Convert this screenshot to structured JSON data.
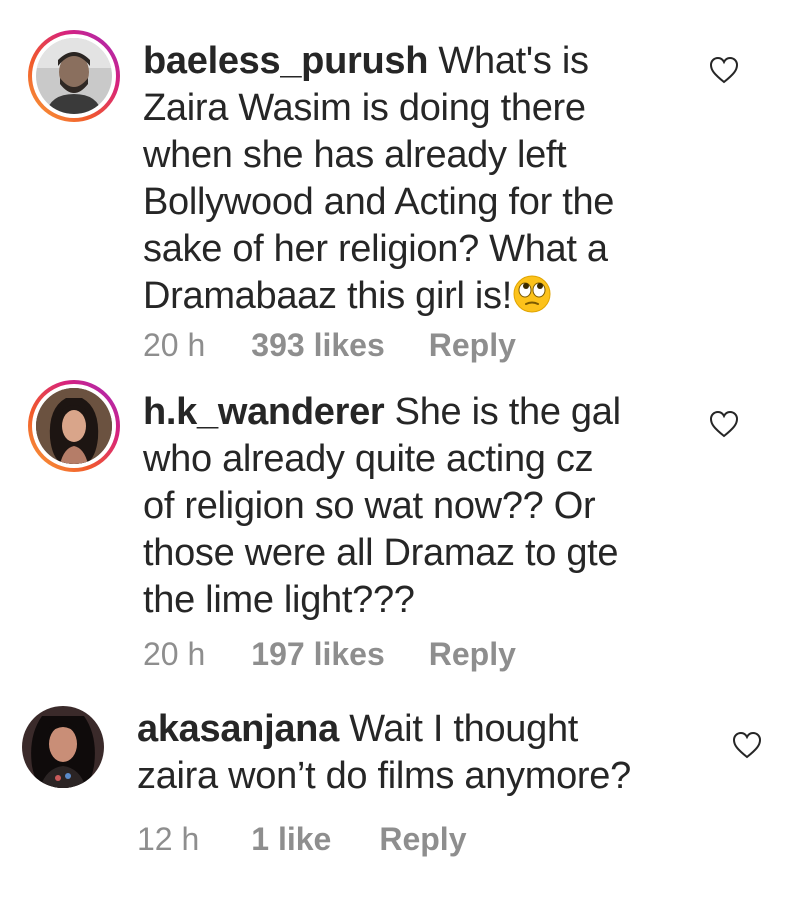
{
  "comments": [
    {
      "username": "baeless_purush",
      "lines": [
        "What's is",
        "Zaira Wasim is doing there",
        "when she has already left",
        "Bollywood and Acting for the",
        "sake of her religion? What a",
        "Dramabaaz this girl is!"
      ],
      "emoji": "face-with-rolling-eyes",
      "time": "20 h",
      "likes": "393 likes",
      "reply": "Reply",
      "has_story_ring": true
    },
    {
      "username": "h.k_wanderer",
      "lines": [
        "She is the gal",
        "who already quite acting cz",
        "of religion so wat now?? Or",
        "those were all Dramaz to gte",
        "the lime light???"
      ],
      "time": "20 h",
      "likes": "197 likes",
      "reply": "Reply",
      "has_story_ring": true
    },
    {
      "username": "akasanjana",
      "lines": [
        "Wait I thought",
        "zaira won’t do films anymore?"
      ],
      "time": "12 h",
      "likes": "1 like",
      "reply": "Reply",
      "has_story_ring": false
    }
  ],
  "icons": {
    "like": "heart-outline-icon"
  },
  "colors": {
    "text": "#262626",
    "meta": "#8e8e8e",
    "ring_start": "#f9a33c",
    "ring_end": "#9b2cc6"
  }
}
